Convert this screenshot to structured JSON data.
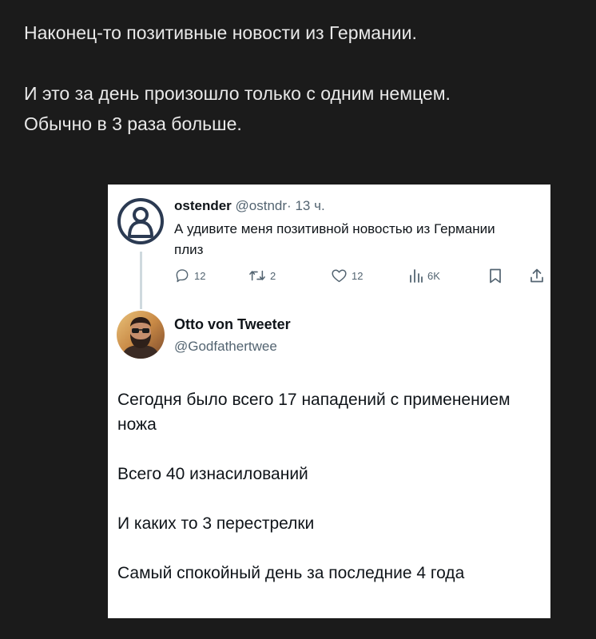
{
  "post": {
    "line1": "Наконец-то позитивные новости из Германии.",
    "line2": "И это за день произошло только с одним немцем.",
    "line3": "Обычно в 3 раза больше."
  },
  "reply_tweet": {
    "name": "ostender",
    "handle": "@ostndr",
    "separator": "·",
    "time": "13 ч.",
    "text": "А удивите меня позитивной новостью из Германии плиз",
    "replies": "12",
    "retweets": "2",
    "likes": "12",
    "views": "6K",
    "icons": [
      "reply-icon",
      "retweet-icon",
      "like-icon",
      "views-icon",
      "bookmark-icon",
      "share-icon"
    ]
  },
  "main_tweet": {
    "name": "Otto von Tweeter",
    "handle": "@Godfathertwee",
    "p1": "Сегодня было всего 17 нападений с применением ножа",
    "p2": "Всего 40 изнасилований",
    "p3": "И каких то 3 перестрелки",
    "p4": "Самый спокойный день за последние 4 года"
  },
  "colors": {
    "page_bg": "#1b1b1b",
    "post_text": "#e9e9e9",
    "card_bg": "#ffffff",
    "muted": "#536471",
    "default_avatar": "#2b3a52"
  }
}
